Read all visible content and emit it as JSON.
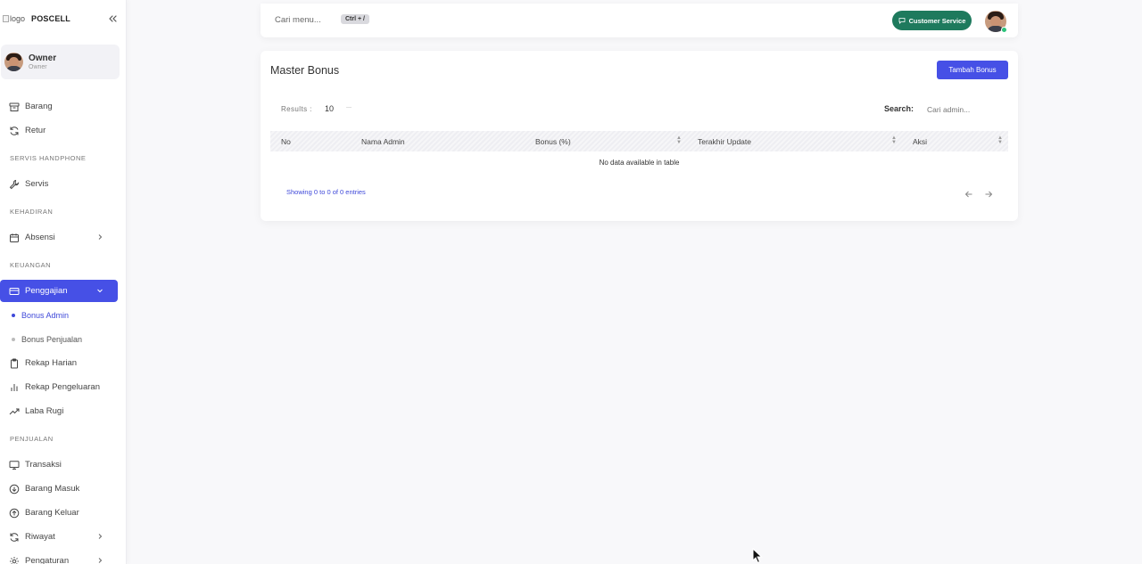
{
  "sidebar": {
    "logo_alt": "logo",
    "brand": "POSCELL",
    "user": {
      "name": "Owner",
      "role": "Owner"
    },
    "items_top": [
      {
        "label": "Barang",
        "icon": "archive-icon"
      },
      {
        "label": "Retur",
        "icon": "refresh-icon"
      }
    ],
    "section_servis": "SERVIS HANDPHONE",
    "servis": {
      "label": "Servis",
      "icon": "wrench-icon"
    },
    "section_kehadiran": "KEHADIRAN",
    "absensi": {
      "label": "Absensi",
      "icon": "calendar-icon"
    },
    "section_keuangan": "KEUANGAN",
    "penggajian": {
      "label": "Penggajian",
      "icon": "credit-card-icon"
    },
    "sub_items": [
      {
        "label": "Bonus Admin",
        "active": true
      },
      {
        "label": "Bonus Penjualan",
        "active": false
      }
    ],
    "keuangan_items": [
      {
        "label": "Rekap Harian",
        "icon": "clipboard-icon"
      },
      {
        "label": "Rekap Pengeluaran",
        "icon": "bar-chart-icon"
      },
      {
        "label": "Laba Rugi",
        "icon": "trending-up-icon"
      }
    ],
    "section_penjualan": "PENJUALAN",
    "penjualan_items": [
      {
        "label": "Transaksi",
        "icon": "monitor-icon"
      },
      {
        "label": "Barang Masuk",
        "icon": "arrow-down-circle-icon"
      },
      {
        "label": "Barang Keluar",
        "icon": "arrow-up-circle-icon"
      },
      {
        "label": "Riwayat",
        "icon": "refresh-icon"
      },
      {
        "label": "Pengaturan",
        "icon": "gear-icon"
      }
    ]
  },
  "topbar": {
    "search_placeholder": "Cari menu...",
    "shortcut": "Ctrl + /",
    "customer_service": "Customer Service"
  },
  "card": {
    "title": "Master Bonus",
    "add_button": "Tambah Bonus",
    "results_label": "Results :",
    "results_value": "10",
    "search_label": "Search:",
    "search_placeholder": "Cari admin...",
    "columns": [
      "No",
      "Nama Admin",
      "Bonus (%)",
      "Terakhir Update",
      "Aksi"
    ],
    "empty_message": "No data available in table",
    "info": "Showing 0 to 0 of 0 entries"
  },
  "colors": {
    "accent": "#4650e6",
    "customer_service": "#1e7a5d",
    "online": "#2cc27a"
  }
}
